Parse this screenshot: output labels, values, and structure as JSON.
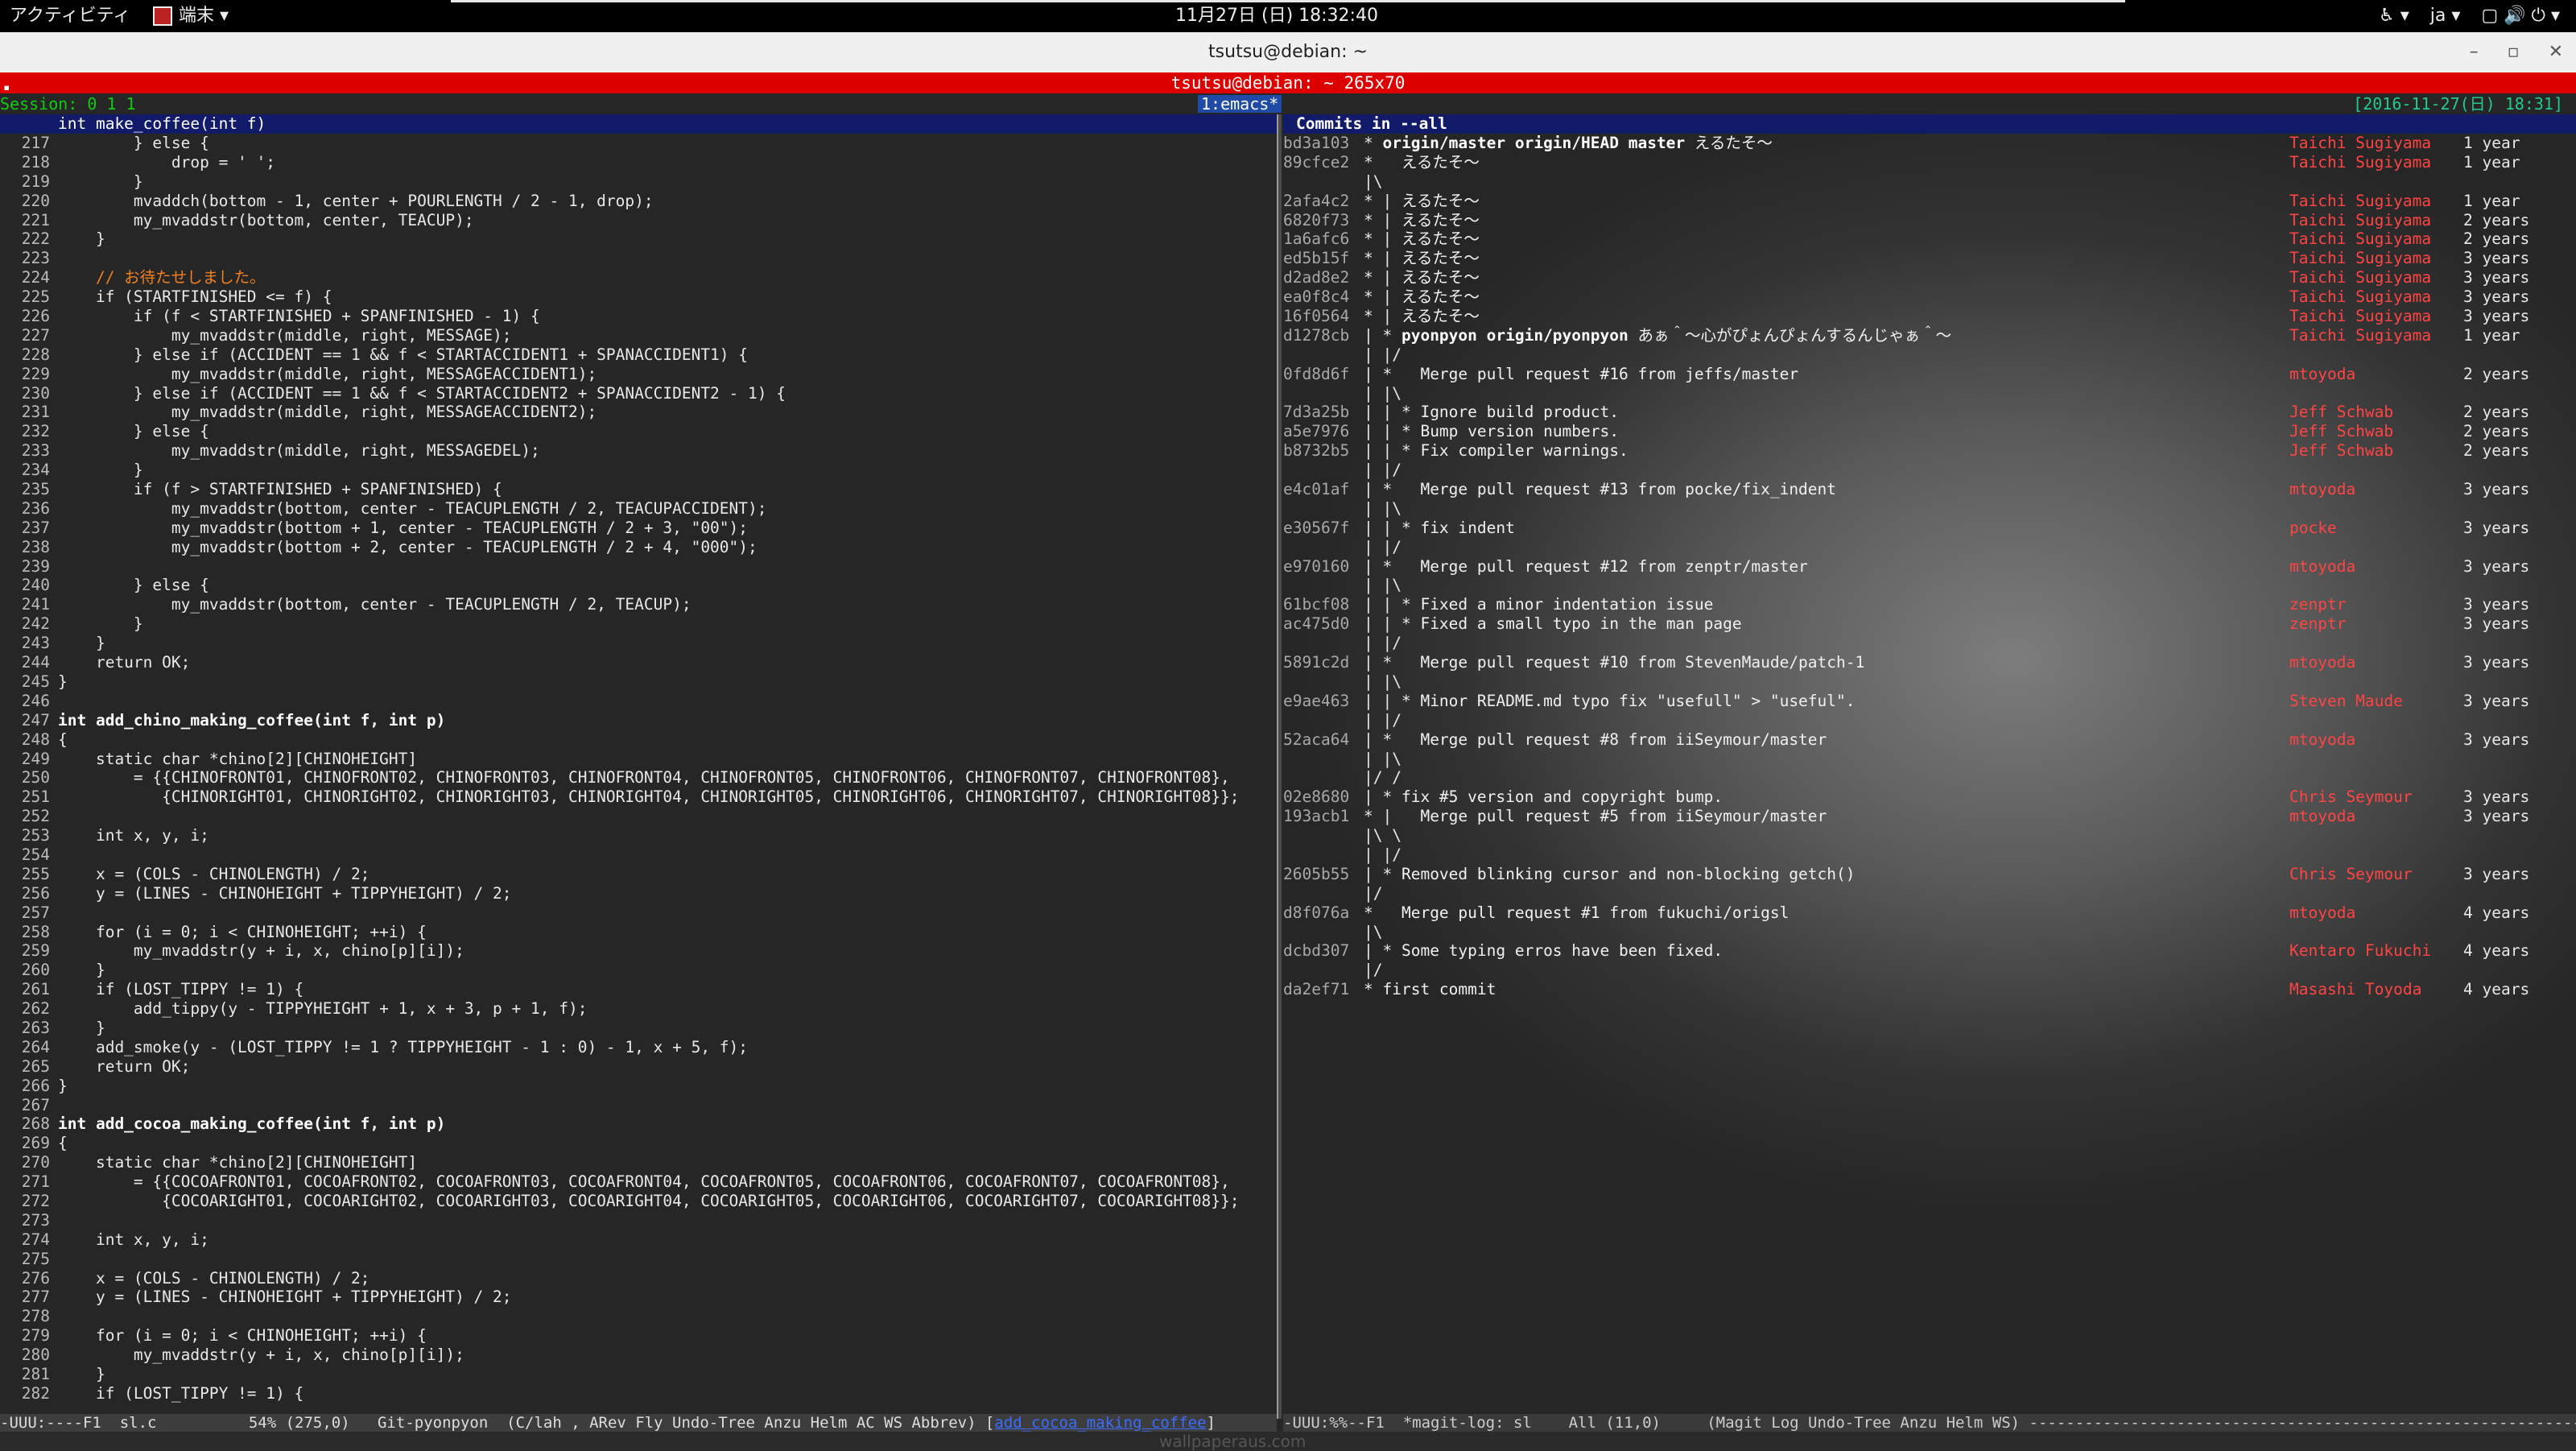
{
  "topbar": {
    "activities": "アクティビティ",
    "app_menu": "端末 ▾",
    "clock": "11月27日 (日) 18:32:40",
    "tray": [
      "♿ ▾",
      "ja ▾",
      "▢ 🔊 ⏻ ▾"
    ]
  },
  "window": {
    "title": "tsutsu@debian: ~",
    "controls": [
      "–",
      "▫",
      "✕"
    ],
    "tmux_title": "tsutsu@debian: ~ 265x70"
  },
  "tmux": {
    "session": "Session: 0 1 1",
    "window_name": "1:emacs*",
    "date": "[2016-11-27(日) 18:31]"
  },
  "left_pane": {
    "header": "int make_coffee(int f)",
    "lines": [
      {
        "n": "217",
        "t": "        } else {"
      },
      {
        "n": "218",
        "t": "            drop = ' ';"
      },
      {
        "n": "219",
        "t": "        }"
      },
      {
        "n": "220",
        "t": "        mvaddch(bottom - 1, center + POURLENGTH / 2 - 1, drop);"
      },
      {
        "n": "221",
        "t": "        my_mvaddstr(bottom, center, TEACUP);"
      },
      {
        "n": "222",
        "t": "    }"
      },
      {
        "n": "223",
        "t": ""
      },
      {
        "n": "224",
        "t": "    // お待たせしました。",
        "c": "cm"
      },
      {
        "n": "225",
        "t": "    if (STARTFINISHED <= f) {"
      },
      {
        "n": "226",
        "t": "        if (f < STARTFINISHED + SPANFINISHED - 1) {"
      },
      {
        "n": "227",
        "t": "            my_mvaddstr(middle, right, MESSAGE);"
      },
      {
        "n": "228",
        "t": "        } else if (ACCIDENT == 1 && f < STARTACCIDENT1 + SPANACCIDENT1) {"
      },
      {
        "n": "229",
        "t": "            my_mvaddstr(middle, right, MESSAGEACCIDENT1);"
      },
      {
        "n": "230",
        "t": "        } else if (ACCIDENT == 1 && f < STARTACCIDENT2 + SPANACCIDENT2 - 1) {"
      },
      {
        "n": "231",
        "t": "            my_mvaddstr(middle, right, MESSAGEACCIDENT2);"
      },
      {
        "n": "232",
        "t": "        } else {"
      },
      {
        "n": "233",
        "t": "            my_mvaddstr(middle, right, MESSAGEDEL);"
      },
      {
        "n": "234",
        "t": "        }"
      },
      {
        "n": "235",
        "t": "        if (f > STARTFINISHED + SPANFINISHED) {"
      },
      {
        "n": "236",
        "t": "            my_mvaddstr(bottom, center - TEACUPLENGTH / 2, TEACUPACCIDENT);"
      },
      {
        "n": "237",
        "t": "            my_mvaddstr(bottom + 1, center - TEACUPLENGTH / 2 + 3, \"00\");"
      },
      {
        "n": "238",
        "t": "            my_mvaddstr(bottom + 2, center - TEACUPLENGTH / 2 + 4, \"000\");"
      },
      {
        "n": "239",
        "t": ""
      },
      {
        "n": "240",
        "t": "        } else {"
      },
      {
        "n": "241",
        "t": "            my_mvaddstr(bottom, center - TEACUPLENGTH / 2, TEACUP);"
      },
      {
        "n": "242",
        "t": "        }"
      },
      {
        "n": "243",
        "t": "    }"
      },
      {
        "n": "244",
        "t": "    return OK;"
      },
      {
        "n": "245",
        "t": "}"
      },
      {
        "n": "246",
        "t": ""
      },
      {
        "n": "247",
        "t": "int add_chino_making_coffee(int f, int p)",
        "c": "hl"
      },
      {
        "n": "248",
        "t": "{"
      },
      {
        "n": "249",
        "t": "    static char *chino[2][CHINOHEIGHT]"
      },
      {
        "n": "250",
        "t": "        = {{CHINOFRONT01, CHINOFRONT02, CHINOFRONT03, CHINOFRONT04, CHINOFRONT05, CHINOFRONT06, CHINOFRONT07, CHINOFRONT08},"
      },
      {
        "n": "251",
        "t": "           {CHINORIGHT01, CHINORIGHT02, CHINORIGHT03, CHINORIGHT04, CHINORIGHT05, CHINORIGHT06, CHINORIGHT07, CHINORIGHT08}};"
      },
      {
        "n": "252",
        "t": ""
      },
      {
        "n": "253",
        "t": "    int x, y, i;"
      },
      {
        "n": "254",
        "t": ""
      },
      {
        "n": "255",
        "t": "    x = (COLS - CHINOLENGTH) / 2;"
      },
      {
        "n": "256",
        "t": "    y = (LINES - CHINOHEIGHT + TIPPYHEIGHT) / 2;"
      },
      {
        "n": "257",
        "t": ""
      },
      {
        "n": "258",
        "t": "    for (i = 0; i < CHINOHEIGHT; ++i) {"
      },
      {
        "n": "259",
        "t": "        my_mvaddstr(y + i, x, chino[p][i]);"
      },
      {
        "n": "260",
        "t": "    }"
      },
      {
        "n": "261",
        "t": "    if (LOST_TIPPY != 1) {"
      },
      {
        "n": "262",
        "t": "        add_tippy(y - TIPPYHEIGHT + 1, x + 3, p + 1, f);"
      },
      {
        "n": "263",
        "t": "    }"
      },
      {
        "n": "264",
        "t": "    add_smoke(y - (LOST_TIPPY != 1 ? TIPPYHEIGHT - 1 : 0) - 1, x + 5, f);"
      },
      {
        "n": "265",
        "t": "    return OK;"
      },
      {
        "n": "266",
        "t": "}"
      },
      {
        "n": "267",
        "t": ""
      },
      {
        "n": "268",
        "t": "int add_cocoa_making_coffee(int f, int p)",
        "c": "hl"
      },
      {
        "n": "269",
        "t": "{"
      },
      {
        "n": "270",
        "t": "    static char *chino[2][CHINOHEIGHT]"
      },
      {
        "n": "271",
        "t": "        = {{COCOAFRONT01, COCOAFRONT02, COCOAFRONT03, COCOAFRONT04, COCOAFRONT05, COCOAFRONT06, COCOAFRONT07, COCOAFRONT08},"
      },
      {
        "n": "272",
        "t": "           {COCOARIGHT01, COCOARIGHT02, COCOARIGHT03, COCOARIGHT04, COCOARIGHT05, COCOARIGHT06, COCOARIGHT07, COCOARIGHT08}};"
      },
      {
        "n": "273",
        "t": ""
      },
      {
        "n": "274",
        "t": "    int x, y, i;"
      },
      {
        "n": "275",
        "t": ""
      },
      {
        "n": "276",
        "t": "    x = (COLS - CHINOLENGTH) / 2;"
      },
      {
        "n": "277",
        "t": "    y = (LINES - CHINOHEIGHT + TIPPYHEIGHT) / 2;"
      },
      {
        "n": "278",
        "t": ""
      },
      {
        "n": "279",
        "t": "    for (i = 0; i < CHINOHEIGHT; ++i) {"
      },
      {
        "n": "280",
        "t": "        my_mvaddstr(y + i, x, chino[p][i]);"
      },
      {
        "n": "281",
        "t": "    }"
      },
      {
        "n": "282",
        "t": "    if (LOST_TIPPY != 1) {"
      }
    ],
    "modeline": "-UUU:----F1  sl.c          54% (275,0)   Git-pyonpyon  (C/lah , ARev Fly Undo-Tree Anzu Helm AC WS Abbrev) [",
    "modeline_fn": "add_cocoa_making_coffee",
    "modeline_end": "]"
  },
  "right_pane": {
    "header": "Commits in --all",
    "commits": [
      {
        "h": "bd3a103",
        "g": "* ",
        "refs": "origin/master origin/HEAD master",
        "m": " えるたそ〜",
        "a": "Taichi Sugiyama",
        "age": "1 year"
      },
      {
        "h": "89cfce2",
        "g": "* ",
        "refs": "",
        "m": "  えるたそ〜",
        "a": "Taichi Sugiyama",
        "age": "1 year"
      },
      {
        "h": "",
        "g": "|\\",
        "refs": "",
        "m": "",
        "a": "",
        "age": ""
      },
      {
        "h": "2afa4c2",
        "g": "* | ",
        "refs": "",
        "m": "えるたそ〜",
        "a": "Taichi Sugiyama",
        "age": "1 year"
      },
      {
        "h": "6820f73",
        "g": "* | ",
        "refs": "",
        "m": "えるたそ〜",
        "a": "Taichi Sugiyama",
        "age": "2 years"
      },
      {
        "h": "1a6afc6",
        "g": "* | ",
        "refs": "",
        "m": "えるたそ〜",
        "a": "Taichi Sugiyama",
        "age": "2 years"
      },
      {
        "h": "ed5b15f",
        "g": "* | ",
        "refs": "",
        "m": "えるたそ〜",
        "a": "Taichi Sugiyama",
        "age": "3 years"
      },
      {
        "h": "d2ad8e2",
        "g": "* | ",
        "refs": "",
        "m": "えるたそ〜",
        "a": "Taichi Sugiyama",
        "age": "3 years"
      },
      {
        "h": "ea0f8c4",
        "g": "* | ",
        "refs": "",
        "m": "えるたそ〜",
        "a": "Taichi Sugiyama",
        "age": "3 years"
      },
      {
        "h": "16f0564",
        "g": "* | ",
        "refs": "",
        "m": "えるたそ〜",
        "a": "Taichi Sugiyama",
        "age": "3 years"
      },
      {
        "h": "d1278cb",
        "g": "| * ",
        "refs": "pyonpyon origin/pyonpyon",
        "m": " あぁ＾〜心がぴょんぴょんするんじゃぁ＾〜",
        "a": "Taichi Sugiyama",
        "age": "1 year"
      },
      {
        "h": "",
        "g": "| |/",
        "refs": "",
        "m": "",
        "a": "",
        "age": ""
      },
      {
        "h": "0fd8d6f",
        "g": "| *   ",
        "refs": "",
        "m": "Merge pull request #16 from jeffs/master",
        "a": "mtoyoda",
        "age": "2 years"
      },
      {
        "h": "",
        "g": "| |\\",
        "refs": "",
        "m": "",
        "a": "",
        "age": ""
      },
      {
        "h": "7d3a25b",
        "g": "| | * ",
        "refs": "",
        "m": "Ignore build product.",
        "a": "Jeff Schwab",
        "age": "2 years"
      },
      {
        "h": "a5e7976",
        "g": "| | * ",
        "refs": "",
        "m": "Bump version numbers.",
        "a": "Jeff Schwab",
        "age": "2 years"
      },
      {
        "h": "b8732b5",
        "g": "| | * ",
        "refs": "",
        "m": "Fix compiler warnings.",
        "a": "Jeff Schwab",
        "age": "2 years"
      },
      {
        "h": "",
        "g": "| |/",
        "refs": "",
        "m": "",
        "a": "",
        "age": ""
      },
      {
        "h": "e4c01af",
        "g": "| *   ",
        "refs": "",
        "m": "Merge pull request #13 from pocke/fix_indent",
        "a": "mtoyoda",
        "age": "3 years"
      },
      {
        "h": "",
        "g": "| |\\",
        "refs": "",
        "m": "",
        "a": "",
        "age": ""
      },
      {
        "h": "e30567f",
        "g": "| | * ",
        "refs": "",
        "m": "fix indent",
        "a": "pocke",
        "age": "3 years"
      },
      {
        "h": "",
        "g": "| |/",
        "refs": "",
        "m": "",
        "a": "",
        "age": ""
      },
      {
        "h": "e970160",
        "g": "| *   ",
        "refs": "",
        "m": "Merge pull request #12 from zenptr/master",
        "a": "mtoyoda",
        "age": "3 years"
      },
      {
        "h": "",
        "g": "| |\\",
        "refs": "",
        "m": "",
        "a": "",
        "age": ""
      },
      {
        "h": "61bcf08",
        "g": "| | * ",
        "refs": "",
        "m": "Fixed a minor indentation issue",
        "a": "zenptr",
        "age": "3 years"
      },
      {
        "h": "ac475d0",
        "g": "| | * ",
        "refs": "",
        "m": "Fixed a small typo in the man page",
        "a": "zenptr",
        "age": "3 years"
      },
      {
        "h": "",
        "g": "| |/",
        "refs": "",
        "m": "",
        "a": "",
        "age": ""
      },
      {
        "h": "5891c2d",
        "g": "| *   ",
        "refs": "",
        "m": "Merge pull request #10 from StevenMaude/patch-1",
        "a": "mtoyoda",
        "age": "3 years"
      },
      {
        "h": "",
        "g": "| |\\",
        "refs": "",
        "m": "",
        "a": "",
        "age": ""
      },
      {
        "h": "e9ae463",
        "g": "| | * ",
        "refs": "",
        "m": "Minor README.md typo fix \"usefull\" > \"useful\".",
        "a": "Steven Maude",
        "age": "3 years"
      },
      {
        "h": "",
        "g": "| |/",
        "refs": "",
        "m": "",
        "a": "",
        "age": ""
      },
      {
        "h": "52aca64",
        "g": "| *   ",
        "refs": "",
        "m": "Merge pull request #8 from iiSeymour/master",
        "a": "mtoyoda",
        "age": "3 years"
      },
      {
        "h": "",
        "g": "| |\\",
        "refs": "",
        "m": "",
        "a": "",
        "age": ""
      },
      {
        "h": "",
        "g": "|/ /",
        "refs": "",
        "m": "",
        "a": "",
        "age": ""
      },
      {
        "h": "02e8680",
        "g": "| * ",
        "refs": "",
        "m": "fix #5 version and copyright bump.",
        "a": "Chris Seymour",
        "age": "3 years"
      },
      {
        "h": "193acb1",
        "g": "* |   ",
        "refs": "",
        "m": "Merge pull request #5 from iiSeymour/master",
        "a": "mtoyoda",
        "age": "3 years"
      },
      {
        "h": "",
        "g": "|\\ \\",
        "refs": "",
        "m": "",
        "a": "",
        "age": ""
      },
      {
        "h": "",
        "g": "| |/",
        "refs": "",
        "m": "",
        "a": "",
        "age": ""
      },
      {
        "h": "2605b55",
        "g": "| * ",
        "refs": "",
        "m": "Removed blinking cursor and non-blocking getch()",
        "a": "Chris Seymour",
        "age": "3 years"
      },
      {
        "h": "",
        "g": "|/",
        "refs": "",
        "m": "",
        "a": "",
        "age": ""
      },
      {
        "h": "d8f076a",
        "g": "*   ",
        "refs": "",
        "m": "Merge pull request #1 from fukuchi/origsl",
        "a": "mtoyoda",
        "age": "4 years"
      },
      {
        "h": "",
        "g": "|\\",
        "refs": "",
        "m": "",
        "a": "",
        "age": ""
      },
      {
        "h": "dcbd307",
        "g": "| * ",
        "refs": "",
        "m": "Some typing erros have been fixed.",
        "a": "Kentaro Fukuchi",
        "age": "4 years"
      },
      {
        "h": "",
        "g": "|/",
        "refs": "",
        "m": "",
        "a": "",
        "age": ""
      },
      {
        "h": "da2ef71",
        "g": "* ",
        "refs": "",
        "m": "first commit",
        "a": "Masashi Toyoda",
        "age": "4 years"
      }
    ],
    "modeline": "-UUU:%%--F1  *magit-log: sl    All (11,0)     (Magit Log Undo-Tree Anzu Helm WS) ----------------------------------------------------------------"
  },
  "watermark": "wallpaperaus.com"
}
